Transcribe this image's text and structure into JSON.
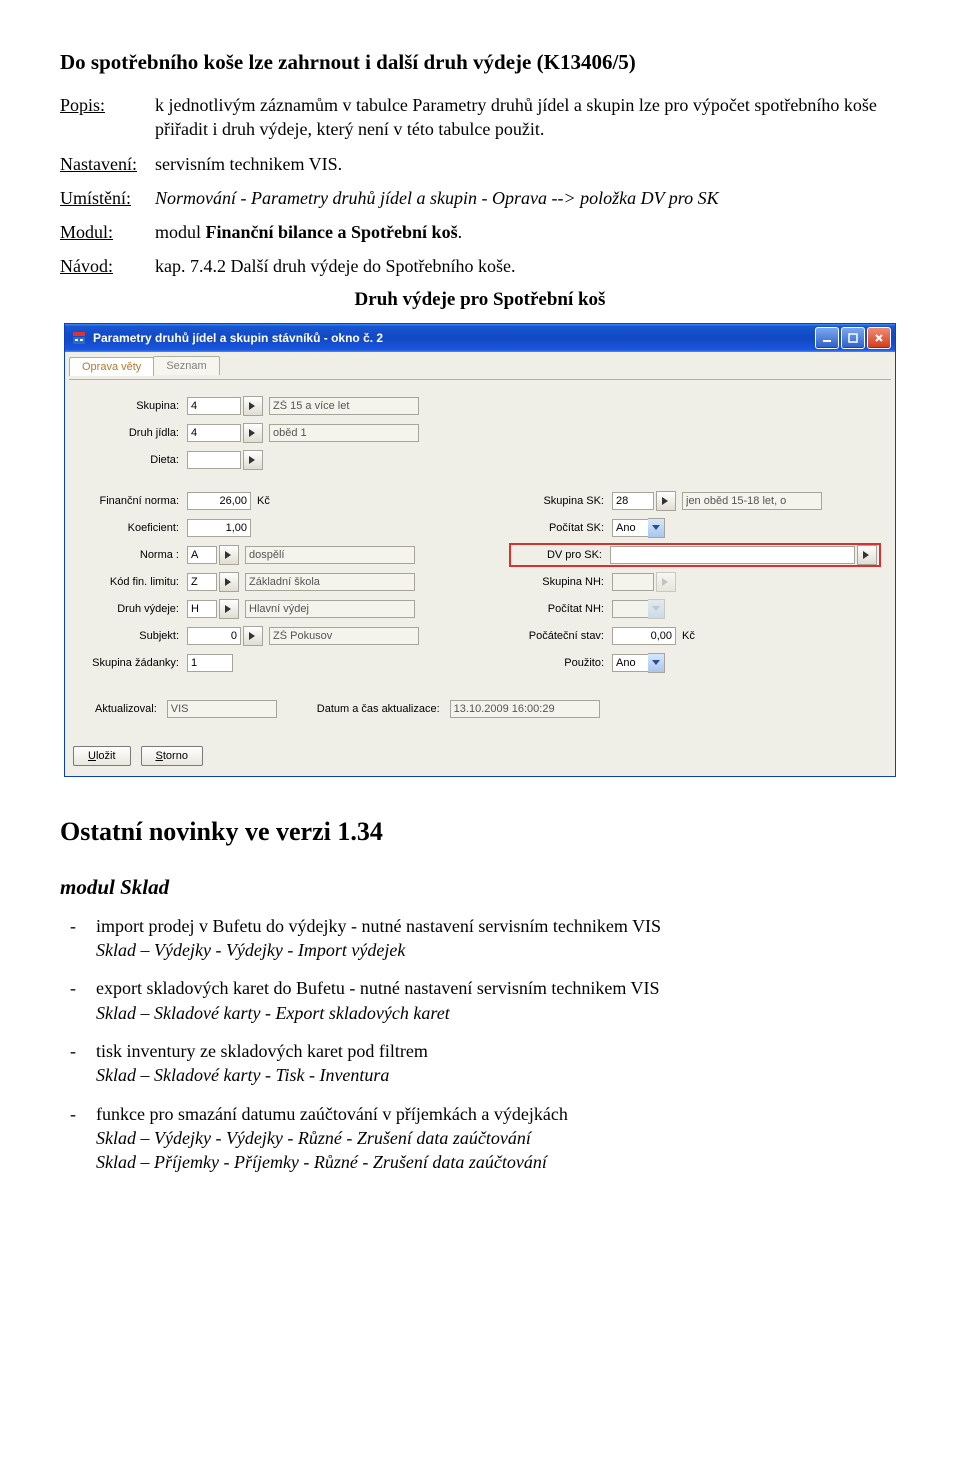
{
  "doc": {
    "title": "Do spotřebního koše lze zahrnout i další druh výdeje (K13406/5)",
    "popis_label": "Popis:",
    "popis_text": "k jednotlivým záznamům v tabulce Parametry druhů jídel a skupin lze pro výpočet spotřebního koše přiřadit i druh výdeje, který není v této tabulce použit.",
    "nastaveni_label": "Nastavení:",
    "nastaveni_text": "servisním technikem VIS.",
    "umisteni_label": "Umístění:",
    "umisteni_text": "Normování - Parametry druhů jídel a skupin - Oprava --> položka DV pro SK",
    "modul_label": "Modul:",
    "modul_text_pre": "modul ",
    "modul_text_bold": "Finanční bilance a Spotřební koš",
    "modul_text_post": ".",
    "navod_label": "Návod:",
    "navod_text": "kap. 7.4.2 Další druh výdeje do Spotřebního koše.",
    "subtitle": "Druh výdeje pro Spotřební koš"
  },
  "win": {
    "title": "Parametry druhů jídel a skupin stávníků - okno č. 2",
    "tabs": {
      "active": "Oprava věty",
      "inactive": "Seznam"
    },
    "labels": {
      "skupina": "Skupina:",
      "druh_jidla": "Druh jídla:",
      "dieta": "Dieta:",
      "fin_norma": "Finanční norma:",
      "koef": "Koeficient:",
      "norma": "Norma :",
      "kod_fin": "Kód fin. limitu:",
      "druh_vydeje": "Druh výdeje:",
      "subjekt": "Subjekt:",
      "skupina_zad": "Skupina žádanky:",
      "skupina_sk": "Skupina SK:",
      "pocitat_sk": "Počítat SK:",
      "dv_pro_sk": "DV pro SK:",
      "skupina_nh": "Skupina NH:",
      "pocitat_nh": "Počítat NH:",
      "poc_stav": "Počáteční stav:",
      "pouzito": "Použito:",
      "aktualizoval": "Aktualizoval:",
      "datum_akt": "Datum a čas aktualizace:",
      "kc": "Kč"
    },
    "vals": {
      "skupina": "4",
      "skupina_desc": "ZŠ 15 a více let",
      "druh_jidla": "4",
      "druh_jidla_desc": "oběd 1",
      "dieta": "",
      "fin_norma": "26,00",
      "koef": "1,00",
      "norma": "A",
      "norma_desc": "dospělí",
      "kod_fin": "Z",
      "kod_fin_desc": "Základní škola",
      "druh_vydeje": "H",
      "druh_vydeje_desc": "Hlavní výdej",
      "subjekt": "0",
      "subjekt_desc": "ZŠ Pokusov",
      "skupina_zad": "1",
      "skupina_sk": "28",
      "skupina_sk_desc": "jen oběd 15-18 let, o",
      "pocitat_sk": "Ano",
      "dv_pro_sk": "",
      "skupina_nh": "",
      "pocitat_nh": "",
      "poc_stav": "0,00",
      "pouzito": "Ano",
      "aktualizoval": "VIS",
      "datum_akt": "13.10.2009 16:00:29"
    },
    "buttons": {
      "ulozit": "Uložit",
      "storno": "Storno"
    }
  },
  "bottom": {
    "heading": "Ostatní novinky ve verzi 1.34",
    "sub": "modul Sklad",
    "items": [
      {
        "text": "import prodej v Bufetu do výdejky - nutné nastavení servisním technikem VIS",
        "italic": "Sklad – Výdejky - Výdejky - Import výdejek"
      },
      {
        "text": "export skladových karet do Bufetu - nutné nastavení servisním technikem VIS",
        "italic": "Sklad – Skladové karty - Export skladových karet"
      },
      {
        "text": "tisk inventury ze skladových karet pod filtrem",
        "italic": "Sklad – Skladové karty - Tisk - Inventura"
      },
      {
        "text": "funkce pro smazání datumu zaúčtování v příjemkách a výdejkách",
        "italic": "Sklad – Výdejky - Výdejky - Různé - Zrušení data zaúčtování",
        "italic2": "Sklad – Příjemky - Příjemky - Různé - Zrušení data zaúčtování"
      }
    ]
  }
}
